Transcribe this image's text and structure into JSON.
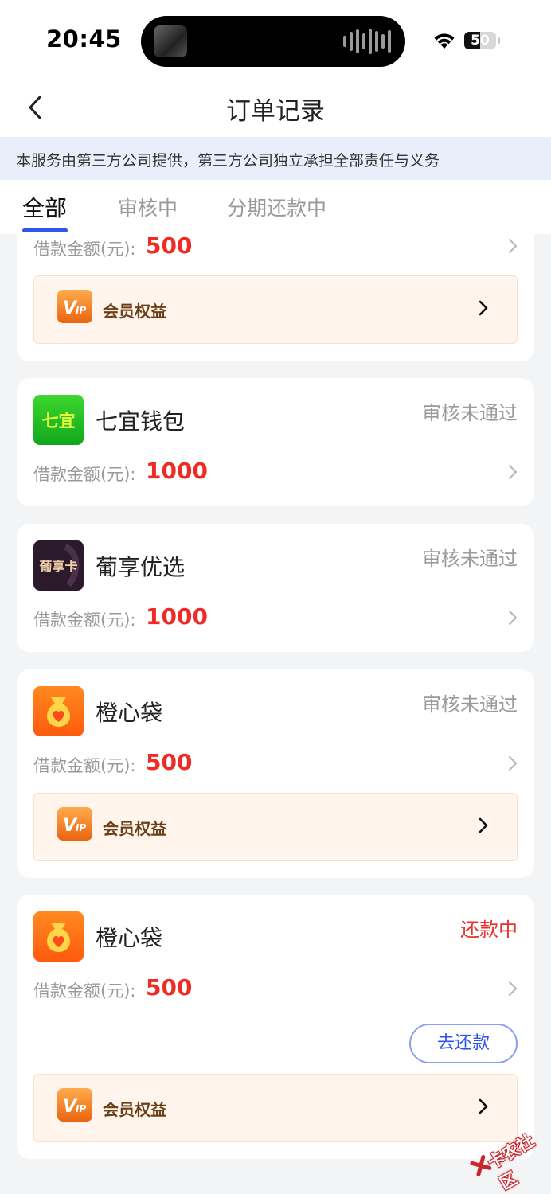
{
  "status_bar": {
    "time": "20:45",
    "battery": "50",
    "battery_level": 0.5,
    "icons": [
      "wifi-icon",
      "battery-icon",
      "now-playing-waveform-icon"
    ]
  },
  "nav": {
    "title": "订单记录",
    "back_icon": "chevron-left-icon"
  },
  "notice": "本服务由第三方公司提供，第三方公司独立承担全部责任与义务",
  "tabs": [
    {
      "label": "全部",
      "active": true
    },
    {
      "label": "审核中",
      "active": false
    },
    {
      "label": "分期还款中",
      "active": false
    }
  ],
  "colors": {
    "accent": "#2f55e8",
    "amount": "#ee2b24",
    "status_gray": "#9b9b9b",
    "status_red": "#e8322d",
    "vip_background": "#fff5ed"
  },
  "orders": [
    {
      "name": "",
      "status": "",
      "amount_label": "借款金额(元):",
      "amount": "500",
      "vip_label": "会员权益"
    },
    {
      "name": "七宜钱包",
      "logo_text": "七宜",
      "status": "审核未通过",
      "amount_label": "借款金额(元):",
      "amount": "1000"
    },
    {
      "name": "葡享优选",
      "logo_text": "葡享卡",
      "status": "审核未通过",
      "amount_label": "借款金额(元):",
      "amount": "1000"
    },
    {
      "name": "橙心袋",
      "status": "审核未通过",
      "amount_label": "借款金额(元):",
      "amount": "500",
      "vip_label": "会员权益"
    },
    {
      "name": "橙心袋",
      "status": "还款中",
      "amount_label": "借款金额(元):",
      "amount": "500",
      "action_label": "去还款",
      "vip_label": "会员权益"
    }
  ],
  "watermark": "卡农社区"
}
